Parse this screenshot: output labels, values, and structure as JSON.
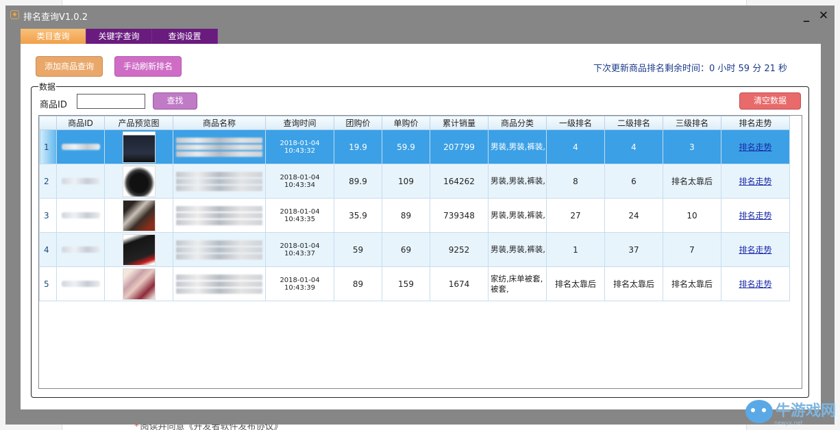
{
  "window": {
    "title": "排名查询V1.0.2",
    "minimize_glyph": "_",
    "close_glyph": "✕"
  },
  "tabs": [
    {
      "label": "类目查询",
      "active": true
    },
    {
      "label": "关键字查询",
      "active": false
    },
    {
      "label": "查询设置",
      "active": false
    }
  ],
  "toolbar": {
    "add_label": "添加商品查询",
    "refresh_label": "手动刷新排名",
    "countdown_text": "下次更新商品排名剩余时间：0 小时 59 分 21 秒"
  },
  "data_group": {
    "legend": "数据",
    "id_label": "商品ID",
    "id_value": "",
    "search_label": "查找",
    "clear_label": "清空数据"
  },
  "table": {
    "columns": [
      "",
      "商品ID",
      "产品预览图",
      "商品名称",
      "查询时间",
      "团购价",
      "单购价",
      "累计销量",
      "商品分类",
      "一级排名",
      "二级排名",
      "三级排名",
      "排名走势"
    ],
    "rows": [
      {
        "num": "1",
        "time": "2018-01-04 10:43:32",
        "group_price": "19.9",
        "single_price": "59.9",
        "sales": "207799",
        "category": "男装,男装,裤装,",
        "rank1": "4",
        "rank2": "4",
        "rank3": "3",
        "trend": "排名走势"
      },
      {
        "num": "2",
        "time": "2018-01-04 10:43:34",
        "group_price": "89.9",
        "single_price": "109",
        "sales": "164262",
        "category": "男装,男装,裤装,",
        "rank1": "8",
        "rank2": "6",
        "rank3": "排名太靠后",
        "trend": "排名走势"
      },
      {
        "num": "3",
        "time": "2018-01-04 10:43:35",
        "group_price": "35.9",
        "single_price": "89",
        "sales": "739348",
        "category": "男装,男装,裤装,",
        "rank1": "27",
        "rank2": "24",
        "rank3": "10",
        "trend": "排名走势"
      },
      {
        "num": "4",
        "time": "2018-01-04 10:43:37",
        "group_price": "59",
        "single_price": "69",
        "sales": "9252",
        "category": "男装,男装,裤装,",
        "rank1": "1",
        "rank2": "37",
        "rank3": "7",
        "trend": "排名走势"
      },
      {
        "num": "5",
        "time": "2018-01-04 10:43:39",
        "group_price": "89",
        "single_price": "159",
        "sales": "1674",
        "category": "家纺,床单被套,被套,",
        "rank1": "排名太靠后",
        "rank2": "排名太靠后",
        "rank3": "排名太靠后",
        "trend": "排名走势"
      }
    ]
  },
  "background": {
    "footer_text": "阅读并同意《开发者软件发布协议》"
  },
  "watermark": {
    "text": "牛游戏网",
    "url": "newyx.net"
  },
  "colors": {
    "tab_active": "#f1a04a",
    "tab_inactive": "#6a1b7e",
    "selected_row": "#3ba0e6",
    "link": "#1a2aa8"
  }
}
